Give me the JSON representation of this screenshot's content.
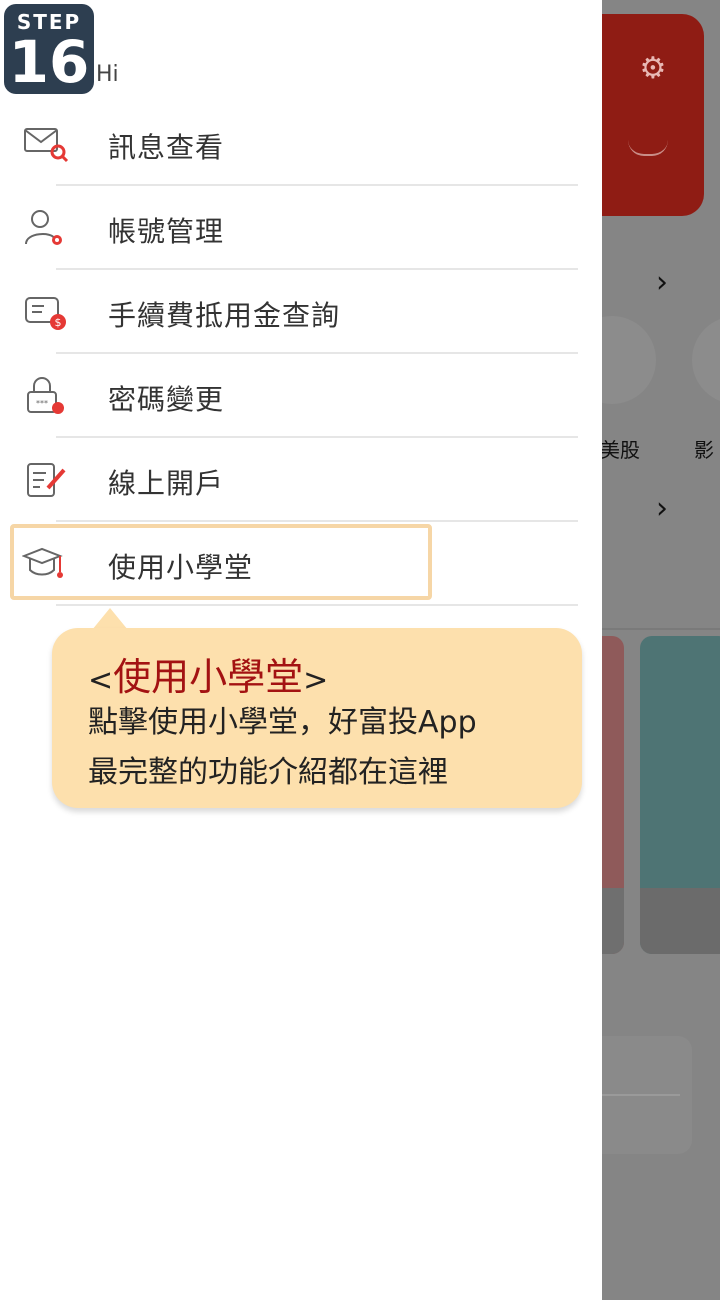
{
  "step": {
    "word": "STEP",
    "number": "16"
  },
  "drawer": {
    "greeting": "Hi",
    "items": [
      {
        "label": "訊息查看",
        "icon": "mail-search-icon"
      },
      {
        "label": "帳號管理",
        "icon": "user-settings-icon"
      },
      {
        "label": "手續費抵用金查詢",
        "icon": "fee-coupon-icon"
      },
      {
        "label": "密碼變更",
        "icon": "lock-icon"
      },
      {
        "label": "線上開戶",
        "icon": "edit-document-icon"
      },
      {
        "label": "使用小學堂",
        "icon": "graduation-cap-icon"
      }
    ]
  },
  "tooltip": {
    "title_open": "<",
    "title_accent": "使用小學堂",
    "title_close": ">",
    "line1": "點擊使用小學堂，好富投App",
    "line2": "最完整的功能介紹都在這裡"
  },
  "background": {
    "label_us_stock": "美股",
    "label_video": "影"
  },
  "colors": {
    "accent_red": "#a31212",
    "tooltip_bg": "#fde0ad",
    "badge_bg": "#2d3e50",
    "icon_red": "#e53935"
  }
}
